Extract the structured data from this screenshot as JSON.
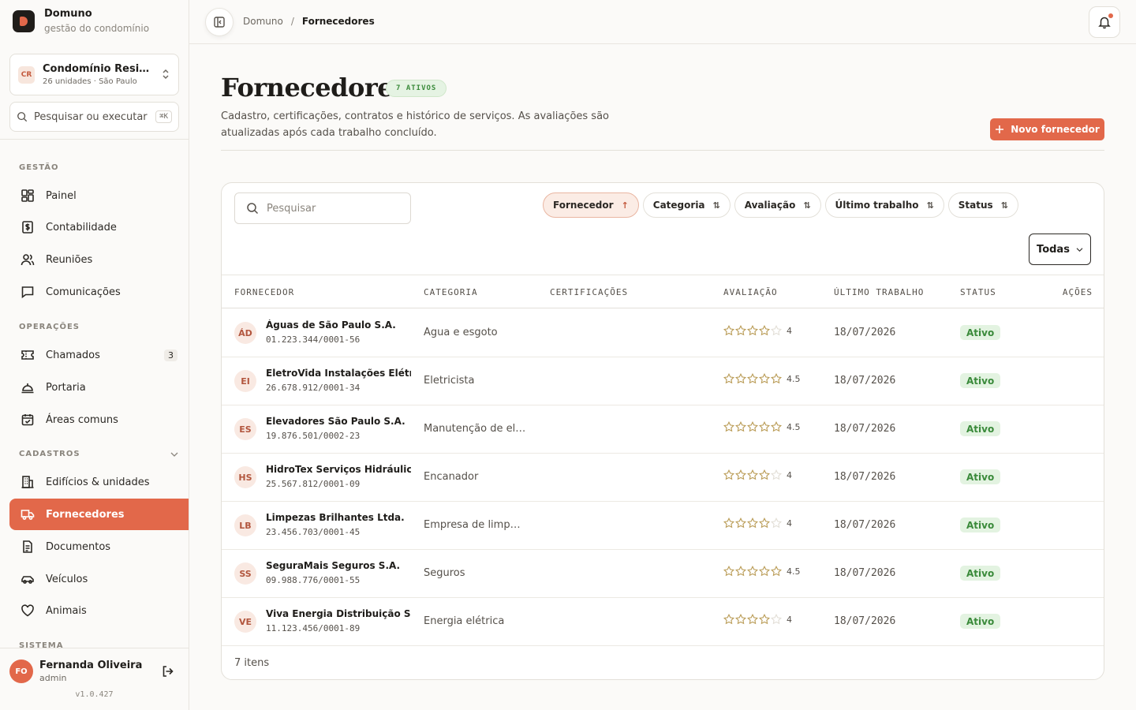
{
  "brand": {
    "name": "Domuno",
    "tagline": "gestão do condomínio"
  },
  "condo": {
    "badge": "CR",
    "name": "Condomínio Residencial",
    "sub": "26 unidades · São Paulo"
  },
  "command": {
    "placeholder": "Pesquisar ou executar comando",
    "shortcut": "⌘K"
  },
  "sections": {
    "gestao": "GESTÃO",
    "operacoes": "OPERAÇÕES",
    "cadastros": "CADASTROS",
    "sistema": "SISTEMA"
  },
  "nav": {
    "painel": "Painel",
    "contabilidade": "Contabilidade",
    "reunioes": "Reuniões",
    "comunicacoes": "Comunicações",
    "chamados": "Chamados",
    "chamados_count": "3",
    "portaria": "Portaria",
    "areas": "Áreas comuns",
    "edificios": "Edifícios & unidades",
    "fornecedores": "Fornecedores",
    "documentos": "Documentos",
    "veiculos": "Veículos",
    "animais": "Animais"
  },
  "user": {
    "initials": "FO",
    "name": "Fernanda Oliveira",
    "role": "admin",
    "version": "v1.0.427"
  },
  "breadcrumb": {
    "root": "Domuno",
    "separator": "/",
    "current": "Fornecedores"
  },
  "page": {
    "title": "Fornecedores",
    "badge": "7 ATIVOS",
    "subtitle": "Cadastro, certificações, contratos e histórico de serviços. As avaliações são atualizadas após cada trabalho concluído.",
    "new_button": "Novo fornecedor"
  },
  "toolbar": {
    "search_placeholder": "Pesquisar",
    "sorts": [
      {
        "label": "Fornecedor",
        "arrow": "↑"
      },
      {
        "label": "Categoria",
        "arrow": "⇅"
      },
      {
        "label": "Avaliação",
        "arrow": "⇅"
      },
      {
        "label": "Último trabalho",
        "arrow": "⇅"
      },
      {
        "label": "Status",
        "arrow": "⇅"
      }
    ],
    "filter": "Todas"
  },
  "table": {
    "columns": [
      "FORNECEDOR",
      "CATEGORIA",
      "CERTIFICAÇÕES",
      "AVALIAÇÃO",
      "ÚLTIMO TRABALHO",
      "STATUS",
      "AÇÕES"
    ],
    "rows": [
      {
        "initials": "ÁD",
        "name": "Águas de São Paulo S.A.",
        "cnpj": "01.223.344/0001-56",
        "category": "Água e esgoto",
        "rating": 4,
        "rating_label": "4",
        "last": "18/07/2026",
        "status": "Ativo"
      },
      {
        "initials": "EI",
        "name": "EletroVida Instalações Elétricas",
        "cnpj": "26.678.912/0001-34",
        "category": "Eletricista",
        "rating": 4.5,
        "rating_label": "4.5",
        "last": "18/07/2026",
        "status": "Ativo"
      },
      {
        "initials": "ES",
        "name": "Elevadores São Paulo S.A.",
        "cnpj": "19.876.501/0002-23",
        "category": "Manutenção de elevadores",
        "rating": 4.5,
        "rating_label": "4.5",
        "last": "18/07/2026",
        "status": "Ativo"
      },
      {
        "initials": "HS",
        "name": "HidroTex Serviços Hidráulicos de",
        "cnpj": "25.567.812/0001-09",
        "category": "Encanador",
        "rating": 4,
        "rating_label": "4",
        "last": "18/07/2026",
        "status": "Ativo"
      },
      {
        "initials": "LB",
        "name": "Limpezas Brilhantes Ltda.",
        "cnpj": "23.456.703/0001-45",
        "category": "Empresa de limpeza",
        "rating": 4,
        "rating_label": "4",
        "last": "18/07/2026",
        "status": "Ativo"
      },
      {
        "initials": "SS",
        "name": "SeguraMais Seguros S.A.",
        "cnpj": "09.988.776/0001-55",
        "category": "Seguros",
        "rating": 4.5,
        "rating_label": "4.5",
        "last": "18/07/2026",
        "status": "Ativo"
      },
      {
        "initials": "VE",
        "name": "Viva Energia Distribuição S.A.",
        "cnpj": "11.123.456/0001-89",
        "category": "Energia elétrica",
        "rating": 4,
        "rating_label": "4",
        "last": "18/07/2026",
        "status": "Ativo"
      }
    ],
    "footer": "7 itens"
  },
  "colors": {
    "accent": "#e2684a",
    "success": "#3a8a3a",
    "star": "#c9a24a"
  }
}
